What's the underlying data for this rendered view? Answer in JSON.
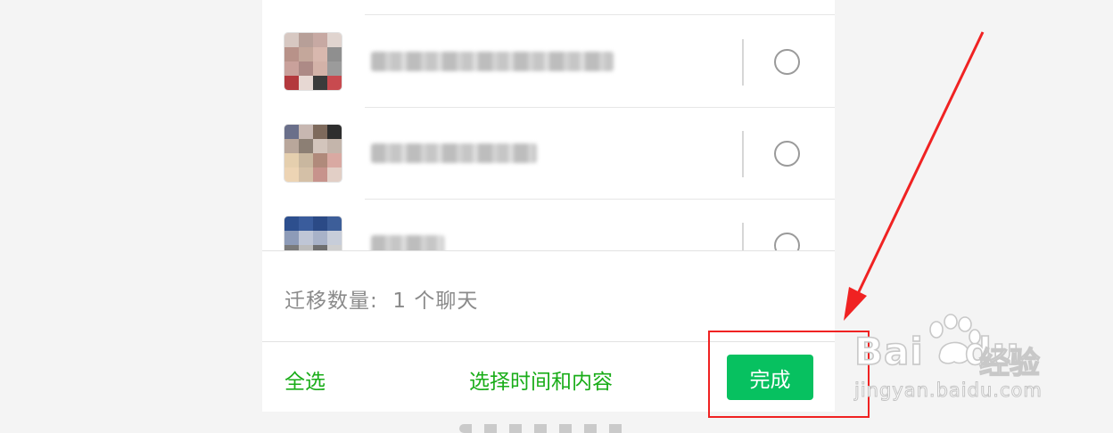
{
  "migration": {
    "count_label": "迁移数量:",
    "count_value": "1 个聊天"
  },
  "footer": {
    "select_all_label": "全选",
    "choose_time_label": "选择时间和内容",
    "done_label": "完成"
  },
  "watermark": {
    "logo_text": "Bai",
    "logo_text_2": "du",
    "brand": "经验",
    "url": "jingyan.baidu.com"
  },
  "colors": {
    "accent_green": "#07c160",
    "link_green": "#1aad19",
    "annotation_red": "#f02222"
  },
  "icons": [
    "radio-unchecked-icon",
    "red-arrow-annotation",
    "baidu-paw-logo"
  ]
}
